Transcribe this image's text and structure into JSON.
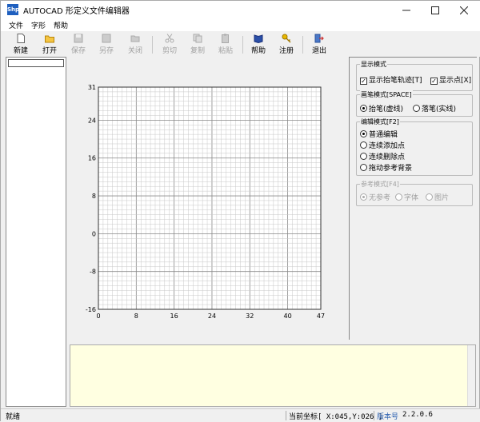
{
  "window": {
    "app_icon_text": "Shp",
    "title": "AUTOCAD 形定义文件编辑器",
    "controls": [
      "minimize-icon",
      "maximize-icon",
      "close-icon"
    ]
  },
  "menu": {
    "items": [
      "文件",
      "字形",
      "帮助"
    ]
  },
  "toolbar": {
    "new": "新建",
    "open": "打开",
    "save": "保存",
    "save_as": "另存",
    "close": "关闭",
    "cut": "剪切",
    "copy": "复制",
    "paste": "粘贴",
    "help": "帮助",
    "register": "注册",
    "exit": "退出"
  },
  "display_mode": {
    "title": "显示模式",
    "show_pen_trace": "显示抬笔轨迹[T]",
    "show_points": "显示点[X]"
  },
  "pen_mode": {
    "title": "画笔模式[SPACE]",
    "pen_up": "抬笔(虚线)",
    "pen_down": "落笔(实线)"
  },
  "edit_mode": {
    "title": "编辑模式[F2]",
    "normal": "普通编辑",
    "add_points": "连续添加点",
    "delete_points": "连续删除点",
    "drag_background": "拖动参考背景"
  },
  "ref_mode": {
    "title": "参考模式[F4]",
    "none": "无参考",
    "font": "字体",
    "image": "图片"
  },
  "chart_data": {
    "type": "grid",
    "xlim": [
      0,
      47
    ],
    "ylim": [
      -16,
      31
    ],
    "x_ticks": [
      "0",
      "8",
      "16",
      "24",
      "32",
      "40",
      "47"
    ],
    "y_ticks": [
      "31",
      "24",
      "16",
      "8",
      "0",
      "-8",
      "-16"
    ]
  },
  "status": {
    "ready": "就绪",
    "coord": "当前坐标[ X:045,Y:026 ]",
    "version_label": "版本号",
    "version": "2.2.0.6"
  }
}
